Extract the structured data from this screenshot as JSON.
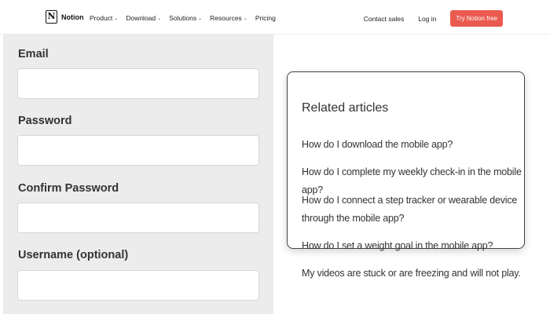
{
  "nav": {
    "logo_text": "Notion",
    "logo_letter": "N",
    "links": [
      "Product",
      "Download",
      "Solutions",
      "Resources"
    ],
    "pricing": "Pricing",
    "contact": "Contact sales",
    "login": "Log in",
    "cta": "Try Notion free"
  },
  "form": {
    "email_label": "Email",
    "password_label": "Password",
    "confirm_label": "Confirm Password",
    "username_label": "Username (optional)"
  },
  "related": {
    "title": "Related articles",
    "articles": [
      "How do I download the mobile app?",
      "How do I complete my weekly check-in in the mobile app?",
      "How do I connect a step tracker or wearable device through the mobile app?",
      "How do I set a weight goal in the mobile app?",
      "My videos are stuck or are freezing and will not play."
    ]
  },
  "colors": {
    "cta": "#eb5a4f",
    "panel": "#ececec"
  }
}
